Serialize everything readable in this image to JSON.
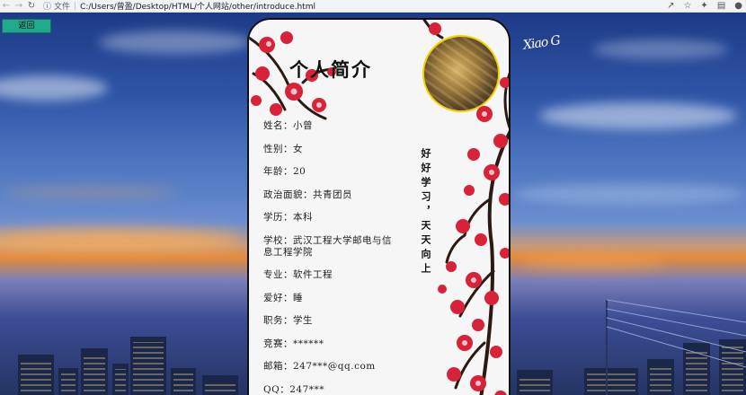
{
  "browser": {
    "file_label": "文件",
    "url": "C:/Users/曾盈/Desktop/HTML/个人网站/other/introduce.html"
  },
  "back_button": {
    "label": "返回"
  },
  "signature": "Xiao G",
  "card": {
    "title": "个人简介",
    "motto": "好好学习，天天向上",
    "items": [
      "姓名：小曾",
      "性别：女",
      "年龄：20",
      "政治面貌：共青团员",
      "学历：本科",
      "学校：武汉工程大学邮电与信息工程学院",
      "专业：软件工程",
      "爱好：睡",
      "职务：学生",
      "竞赛：******",
      "邮箱：247***@qq.com",
      "QQ：247***"
    ]
  }
}
